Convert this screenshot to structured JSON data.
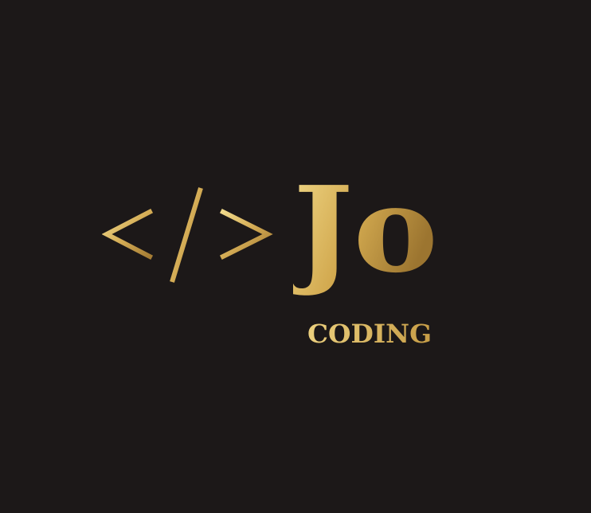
{
  "logo": {
    "symbol": "</>",
    "name": "Jo",
    "tagline": "CODING"
  },
  "colors": {
    "background": "#1c1818",
    "gold_light": "#f3dc8c",
    "gold_mid": "#d6ae55",
    "gold_dark": "#9c7530"
  }
}
